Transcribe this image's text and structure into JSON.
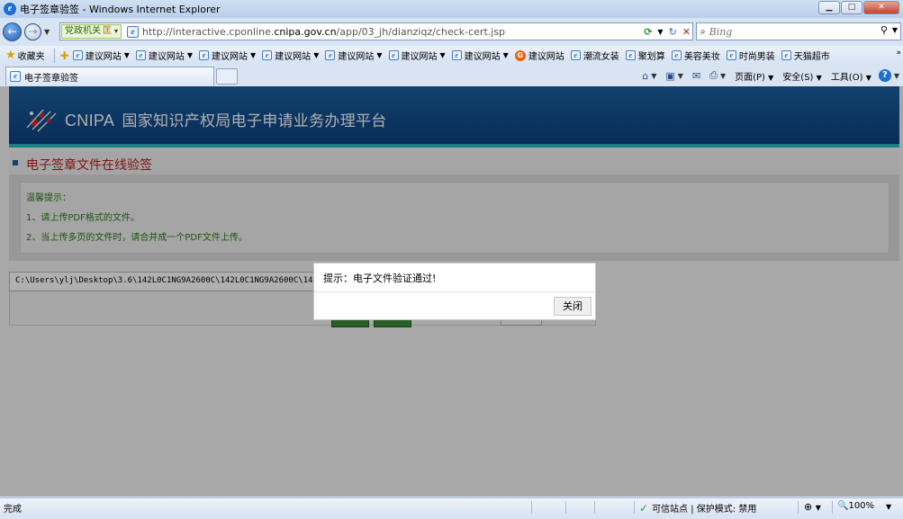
{
  "window": {
    "title": "电子签章验签 - Windows Internet Explorer"
  },
  "address_bar": {
    "tag_label": "党政机关",
    "tag_badge": "匡",
    "url": "http://interactive.cponline.cnipa.gov.cn/app/03_jh/dianziqz/check-cert.jsp"
  },
  "search": {
    "placeholder": "Bing"
  },
  "favorites_bar": {
    "favorites_label": "收藏夹",
    "items": [
      {
        "label": "建议网站",
        "dropdown": true
      },
      {
        "label": "建议网站",
        "dropdown": true
      },
      {
        "label": "建议网站",
        "dropdown": true
      },
      {
        "label": "建议网站",
        "dropdown": true
      },
      {
        "label": "建议网站",
        "dropdown": true
      },
      {
        "label": "建议网站",
        "dropdown": true
      },
      {
        "label": "建议网站",
        "dropdown": true
      },
      {
        "label": "建议网站",
        "dropdown": false,
        "icon": "orange-g"
      },
      {
        "label": "潮流女装",
        "dropdown": false
      },
      {
        "label": "聚划算",
        "dropdown": false
      },
      {
        "label": "美容美妆",
        "dropdown": false
      },
      {
        "label": "时尚男装",
        "dropdown": false
      },
      {
        "label": "天猫超市",
        "dropdown": false
      }
    ]
  },
  "tab": {
    "label": "电子签章验签"
  },
  "command_bar": {
    "page_label": "页面(P)",
    "safety_label": "安全(S)",
    "tools_label": "工具(O)"
  },
  "page": {
    "brand": "CNIPA",
    "platform_name": "国家知识产权局电子申请业务办理平台",
    "section_title": "电子签章文件在线验签",
    "notice": {
      "heading": "温馨提示：",
      "line1": "1、请上传PDF格式的文件。",
      "line2": "2、当上传多页的文件时，请合并成一个PDF文件上传。"
    },
    "file_path": "C:\\Users\\ylj\\Desktop\\3.6\\142L0C1NG9A2600C\\142L0C1NG9A2600C\\14"
  },
  "dialog": {
    "message": "提示：电子文件验证通过!",
    "close_label": "关闭"
  },
  "status_bar": {
    "status": "完成",
    "zone": "可信站点 | 保护模式: 禁用",
    "zoom": "100%"
  }
}
